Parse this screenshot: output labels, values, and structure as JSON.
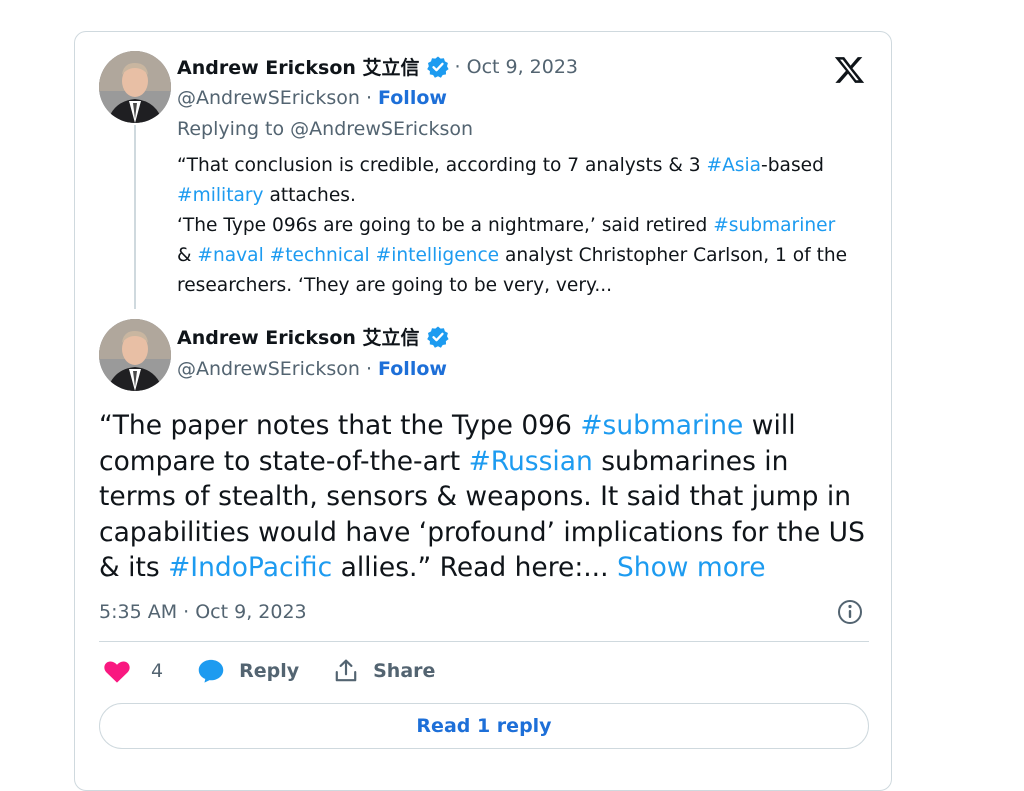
{
  "quoted_tweet": {
    "author_name": "Andrew Erickson 艾立信",
    "handle": "@AndrewSErickson",
    "separator": "·",
    "follow_label": "Follow",
    "date": "· Oct 9, 2023",
    "replying_to": "Replying to @AndrewSErickson",
    "line1_a": "“That conclusion is credible, according to 7 analysts & 3 ",
    "tag_asia": "#Asia",
    "line1_b": "-based",
    "tag_military": "#military",
    "line2_b": " attaches.",
    "line3_a": "‘The Type 096s are going to be a nightmare,’ said retired ",
    "tag_submariner": "#submariner",
    "line4_a": "& ",
    "tag_naval": "#naval",
    "tag_technical": "#technical",
    "tag_intelligence": "#intelligence",
    "line4_b": " analyst Christopher Carlson, 1 of the",
    "line5": "researchers. ‘They are going to be very, very..."
  },
  "main_tweet": {
    "author_name": "Andrew Erickson 艾立信",
    "handle": "@AndrewSErickson",
    "separator": "·",
    "follow_label": "Follow",
    "text_a": "“The paper notes that the Type 096 ",
    "tag_submarine": "#submarine",
    "text_b": " will compare to state-of-the-art ",
    "tag_russian": "#Russian",
    "text_c": " submarines in terms of stealth, sensors & weapons. It said that jump in capabilities would have ‘profound’ implications for the US & its ",
    "tag_indopacific": "#IndoPacific",
    "text_d": " allies.” Read here:... ",
    "show_more": "Show more",
    "timestamp": "5:35 AM · Oct 9, 2023"
  },
  "actions": {
    "like_count": "4",
    "reply_label": "Reply",
    "share_label": "Share"
  },
  "read_replies_label": "Read 1 reply",
  "colors": {
    "link": "#1d9bf0",
    "follow": "#1d6fd8",
    "like": "#f91880",
    "verified": "#1d9bf0",
    "border": "#cfd9de",
    "muted": "#536471"
  },
  "icons": {
    "brand": "x-logo-icon",
    "verified": "verified-badge-icon",
    "like": "heart-icon",
    "reply": "reply-bubble-icon",
    "share": "share-icon",
    "info": "info-icon"
  }
}
